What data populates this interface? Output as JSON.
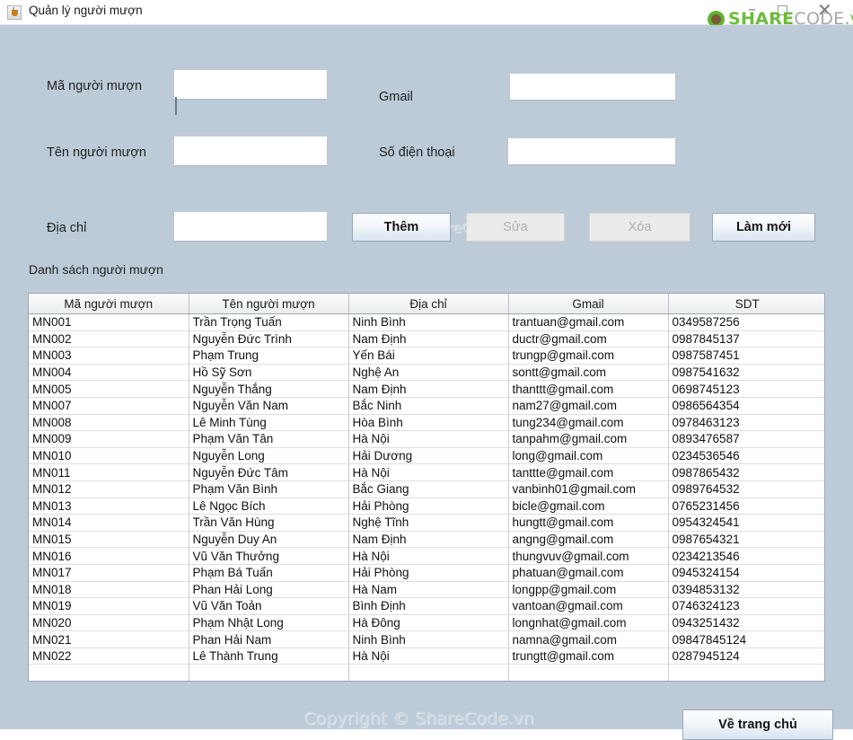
{
  "window": {
    "title": "Quản lý người mượn",
    "icon": "java-app-icon",
    "controls": {
      "minimize": "–",
      "maximize": "□",
      "close": "✕"
    }
  },
  "logo": {
    "mark": "sharecode-logo-icon",
    "share": "SHARE",
    "code": "CODE",
    "vn": ".vn",
    "green": "#6cbb3c",
    "gray": "#a8a8a8"
  },
  "form": {
    "fields": [
      {
        "label": "Mã người mượn",
        "value": "",
        "placeholder": ""
      },
      {
        "label": "Tên người mượn",
        "value": "",
        "placeholder": ""
      },
      {
        "label": "Địa chỉ",
        "value": "",
        "placeholder": ""
      },
      {
        "label": "Gmail",
        "value": "",
        "placeholder": ""
      },
      {
        "label": "Số điện thoại",
        "value": "",
        "placeholder": ""
      }
    ],
    "buttons": [
      {
        "label": "Thêm",
        "enabled": true
      },
      {
        "label": "Sửa",
        "enabled": false
      },
      {
        "label": "Xóa",
        "enabled": false
      },
      {
        "label": "Làm mới",
        "enabled": true
      }
    ]
  },
  "list": {
    "caption": "Danh sách người mượn",
    "columns": [
      "Mã người mượn",
      "Tên người mượn",
      "Địa chỉ",
      "Gmail",
      "SDT"
    ],
    "rows": [
      [
        "MN001",
        "Trần Trọng Tuấn",
        "Ninh Bình",
        "trantuan@gmail.com",
        "0349587256"
      ],
      [
        "MN002",
        "Nguyễn Đức Trình",
        "Nam Định",
        "ductr@gmail.com",
        "0987845137"
      ],
      [
        "MN003",
        "Phạm Trung",
        "Yến Bái",
        "trungp@gmail.com",
        "0987587451"
      ],
      [
        "MN004",
        "Hồ Sỹ Sơn",
        "Nghệ An",
        "sontt@gmail.com",
        "0987541632"
      ],
      [
        "MN005",
        "Nguyễn Thắng",
        "Nam Định",
        "thanttt@gmail.com",
        "0698745123"
      ],
      [
        "MN007",
        "Nguyễn Văn Nam",
        "Bắc Ninh",
        "nam27@gmail.com",
        "0986564354"
      ],
      [
        "MN008",
        "Lê Minh Tùng",
        "Hòa Bình",
        "tung234@gmail.com",
        "0978463123"
      ],
      [
        "MN009",
        "Phạm Văn Tân",
        "Hà Nội",
        "tanpahm@gmail.com",
        "0893476587"
      ],
      [
        "MN010",
        "Nguyễn Long",
        "Hải Dương",
        "long@gmail.com",
        "0234536546"
      ],
      [
        "MN011",
        "Nguyễn Đức Tâm",
        "Hà Nội",
        "tanttte@gmail.com",
        "0987865432"
      ],
      [
        "MN012",
        "Phạm Văn Bình",
        "Bắc Giang",
        "vanbinh01@gmail.com",
        "0989764532"
      ],
      [
        "MN013",
        "Lê Ngọc Bích",
        "Hải Phòng",
        "bicle@gmail.com",
        "0765231456"
      ],
      [
        "MN014",
        "Trần Văn Hùng",
        "Nghệ Tĩnh",
        "hungtt@gmail.com",
        "0954324541"
      ],
      [
        "MN015",
        "Nguyễn Duy An",
        "Nam Định",
        "angng@gmail.com",
        "0987654321"
      ],
      [
        "MN016",
        "Vũ Văn Thưởng",
        "Hà Nội",
        "thungvuv@gmail.com",
        "0234213546"
      ],
      [
        "MN017",
        "Phạm Bá Tuấn",
        "Hải Phòng",
        "phatuan@gmail.com",
        "0945324154"
      ],
      [
        "MN018",
        "Phan Hải Long",
        "Hà Nam",
        "longpp@gmail.com",
        "0394853132"
      ],
      [
        "MN019",
        "Vũ Văn Toản",
        "Bình Định",
        "vantoan@gmail.com",
        "0746324123"
      ],
      [
        "MN020",
        "Phạm Nhật Long",
        "Hà Đông",
        "longnhat@gmail.com",
        "0943251432"
      ],
      [
        "MN021",
        "Phan Hải Nam",
        "Ninh Bình",
        "namna@gmail.com",
        "09847845124"
      ],
      [
        "MN022",
        "Lê Thành Trung",
        "Hà Nội",
        "trungtt@gmail.com",
        "0287945124"
      ]
    ]
  },
  "watermarks": {
    "form": "ShareCode.vn",
    "footer": "Copyright © ShareCode.vn"
  },
  "footer": {
    "home_button": "Về trang chủ"
  }
}
